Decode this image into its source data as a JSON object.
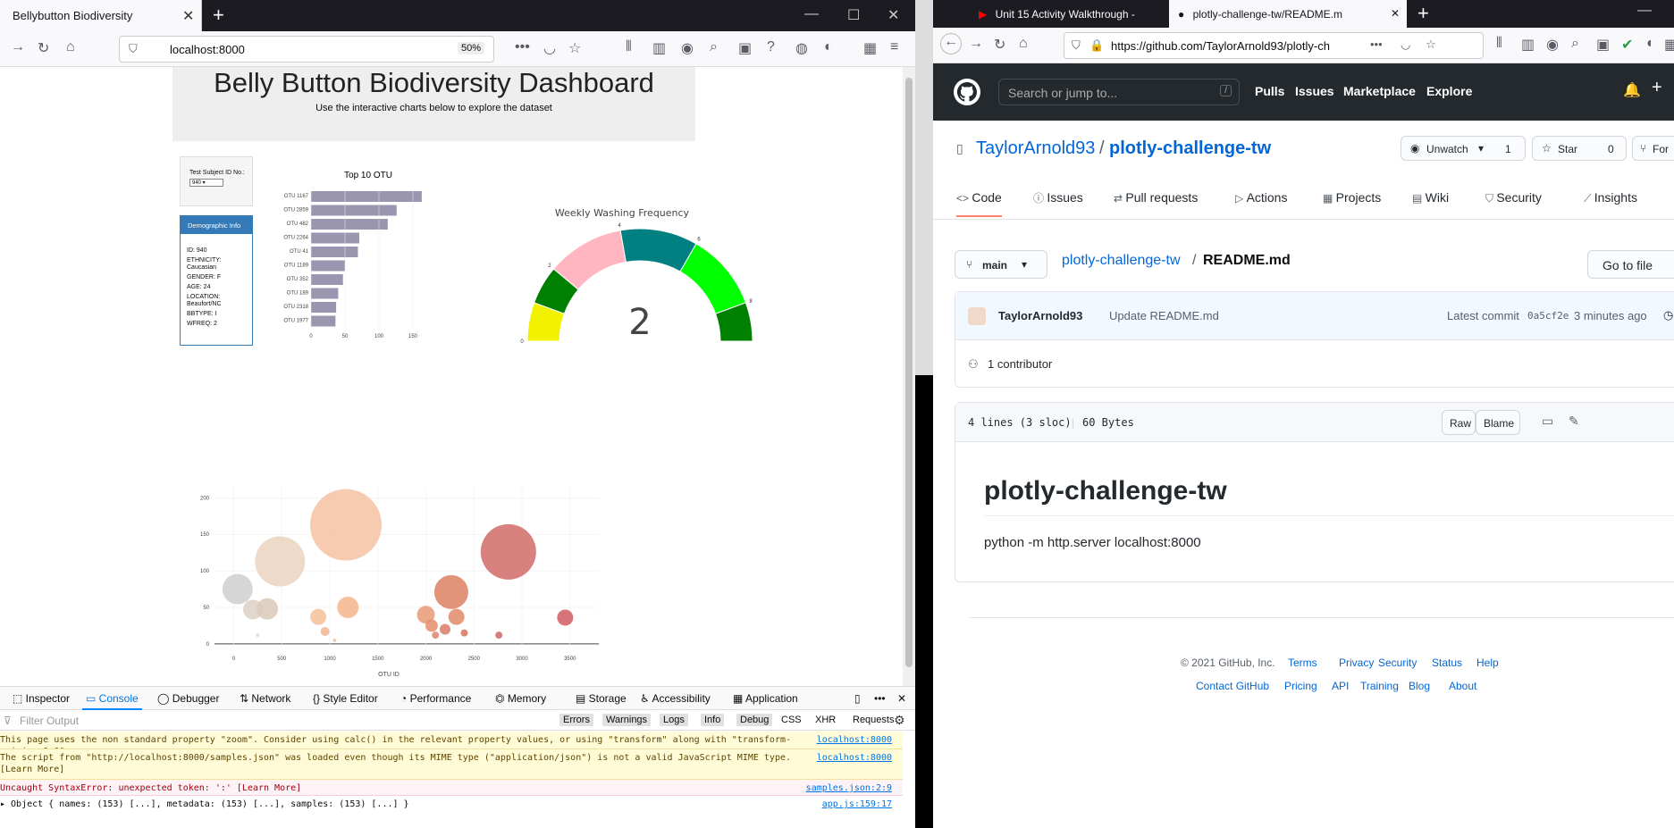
{
  "left_browser": {
    "tab_title": "Bellybutton Biodiversity",
    "url": "localhost:8000",
    "zoom": "50%"
  },
  "dashboard": {
    "title": "Belly Button Biodiversity Dashboard",
    "subtitle": "Use the interactive charts below to explore the dataset",
    "select_label": "Test Subject ID No.:",
    "select_value": "940",
    "demo_header": "Demographic Info",
    "demo_rows": [
      "ID: 940",
      "ETHNICITY: Caucasian",
      "GENDER: F",
      "AGE: 24",
      "LOCATION: Beaufort/NC",
      "BBTYPE: I",
      "WFREQ: 2"
    ],
    "gauge_title": "Weekly Washing Frequency",
    "gauge_value": "2",
    "gauge_ticks": [
      "0",
      "2",
      "4",
      "6",
      "8"
    ],
    "bubble_xlabel": "OTU ID"
  },
  "chart_data": [
    {
      "type": "bar",
      "title": "Top 10 OTU",
      "orientation": "horizontal",
      "categories": [
        "OTU 1167",
        "OTU 2859",
        "OTU 482",
        "OTU 2264",
        "OTU 41",
        "OTU 1189",
        "OTU 352",
        "OTU 189",
        "OTU 2318",
        "OTU 1977"
      ],
      "values": [
        163,
        126,
        113,
        71,
        69,
        50,
        47,
        40,
        37,
        36
      ],
      "xticks": [
        "0",
        "50",
        "100",
        "150"
      ],
      "xlim": [
        0,
        175
      ],
      "color": "#9b96b0"
    },
    {
      "type": "scatter",
      "subtype": "bubble",
      "xlabel": "OTU ID",
      "xticks": [
        "0",
        "500",
        "1000",
        "1500",
        "2000",
        "2500",
        "3000",
        "3500"
      ],
      "yticks": [
        "0",
        "50",
        "100",
        "150",
        "200"
      ],
      "xlim": [
        -200,
        3800
      ],
      "ylim": [
        -5,
        215
      ],
      "points": [
        {
          "x": 40,
          "y": 75,
          "r": 17,
          "c": "#cfcfcf"
        },
        {
          "x": 200,
          "y": 47,
          "r": 11,
          "c": "#ddd0c6"
        },
        {
          "x": 350,
          "y": 48,
          "r": 12,
          "c": "#dbc9bb"
        },
        {
          "x": 482,
          "y": 113,
          "r": 28,
          "c": "#ead3c0"
        },
        {
          "x": 1167,
          "y": 163,
          "r": 40,
          "c": "#f4c2a1"
        },
        {
          "x": 880,
          "y": 37,
          "r": 9,
          "c": "#f5c09a"
        },
        {
          "x": 950,
          "y": 17,
          "r": 5,
          "c": "#f3b58d"
        },
        {
          "x": 1189,
          "y": 50,
          "r": 12,
          "c": "#f3b58a"
        },
        {
          "x": 2000,
          "y": 40,
          "r": 10,
          "c": "#e79a75"
        },
        {
          "x": 2060,
          "y": 25,
          "r": 7,
          "c": "#e58f6c"
        },
        {
          "x": 2264,
          "y": 71,
          "r": 19,
          "c": "#dc8162"
        },
        {
          "x": 2318,
          "y": 37,
          "r": 9,
          "c": "#e08a6a"
        },
        {
          "x": 2200,
          "y": 20,
          "r": 6,
          "c": "#dc7a66"
        },
        {
          "x": 2100,
          "y": 12,
          "r": 4,
          "c": "#dd8570"
        },
        {
          "x": 2400,
          "y": 15,
          "r": 4,
          "c": "#d87360"
        },
        {
          "x": 2859,
          "y": 126,
          "r": 31,
          "c": "#d26b68"
        },
        {
          "x": 2760,
          "y": 12,
          "r": 4,
          "c": "#d06767"
        },
        {
          "x": 3450,
          "y": 36,
          "r": 9,
          "c": "#cf5c63"
        },
        {
          "x": 250,
          "y": 12,
          "r": 2,
          "c": "#dadada"
        },
        {
          "x": 1050,
          "y": 5,
          "r": 2,
          "c": "#eec3a8"
        }
      ]
    },
    {
      "type": "gauge",
      "title": "Weekly Washing Frequency",
      "value": 2,
      "range": [
        0,
        9
      ],
      "ticks": [
        0,
        2,
        4,
        6,
        8
      ]
    }
  ],
  "devtools": {
    "tabs": [
      "Inspector",
      "Console",
      "Debugger",
      "Network",
      "Style Editor",
      "Performance",
      "Memory",
      "Storage",
      "Accessibility",
      "Application"
    ],
    "filters": [
      "Errors",
      "Warnings",
      "Logs",
      "Info",
      "Debug",
      "CSS",
      "XHR",
      "Requests"
    ],
    "filter_placeholder": "Filter Output",
    "messages": [
      {
        "text": "This page uses the non standard property \"zoom\". Consider using calc() in the relevant property values, or using \"transform\" along with \"transform-origin: 0 0\".",
        "src": "localhost:8000",
        "kind": "warn"
      },
      {
        "text": "The script from \"http://localhost:8000/samples.json\" was loaded even though its MIME type (\"application/json\") is not a valid JavaScript MIME type. [Learn More]",
        "src": "localhost:8000",
        "kind": "warn"
      },
      {
        "text": "Uncaught SyntaxError: unexpected token: ':' [Learn More]",
        "src": "samples.json:2:9",
        "kind": "err"
      },
      {
        "text": "▸ Object { names: (153) [...], metadata: (153) [...], samples: (153) [...] }",
        "src": "app.js:159:17",
        "kind": "log"
      }
    ]
  },
  "right_browser": {
    "tab1": "Unit 15 Activity Walkthrough -",
    "tab2": "plotly-challenge-tw/README.m",
    "url": "https://github.com/TaylorArnold93/plotly-ch",
    "search": "Search or jump to...",
    "search_key": "/",
    "nav": [
      "Pulls",
      "Issues",
      "Marketplace",
      "Explore"
    ],
    "owner": "TaylorArnold93",
    "repo": "plotly-challenge-tw",
    "unwatch": "Unwatch",
    "unwatch_count": "1",
    "star": "Star",
    "star_count": "0",
    "fork": "For",
    "repo_tabs": [
      "Code",
      "Issues",
      "Pull requests",
      "Actions",
      "Projects",
      "Wiki",
      "Security",
      "Insights"
    ],
    "branch": "main",
    "breadcrumb_repo": "plotly-challenge-tw",
    "breadcrumb_file": "README.md",
    "goto_file": "Go to file",
    "commit_author": "TaylorArnold93",
    "commit_msg": "Update README.md",
    "latest_commit": "Latest commit",
    "commit_sha": "0a5cf2e",
    "commit_time": "3 minutes ago",
    "history": "H",
    "contributors": "1 contributor",
    "file_info": "4 lines (3 sloc)",
    "file_size": "60 Bytes",
    "raw": "Raw",
    "blame": "Blame",
    "readme_title": "plotly-challenge-tw",
    "readme_body": "python -m http.server localhost:8000",
    "footer_copy": "© 2021 GitHub, Inc.",
    "footer_links1": [
      "Terms",
      "Privacy",
      "Security",
      "Status",
      "Help"
    ],
    "footer_links2": [
      "Contact GitHub",
      "Pricing",
      "API",
      "Training",
      "Blog",
      "About"
    ]
  }
}
